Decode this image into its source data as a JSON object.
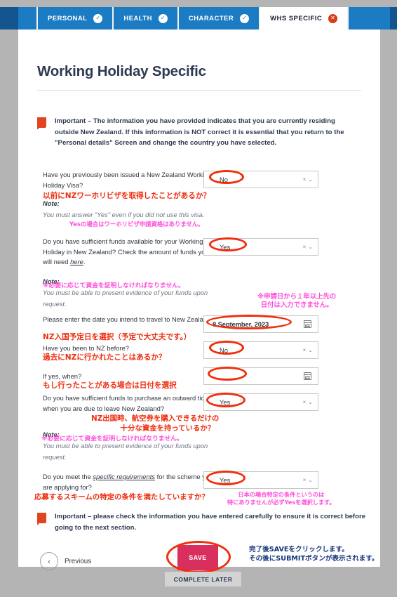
{
  "tabs": [
    {
      "label": "PERSONAL",
      "badge": "check",
      "active": false
    },
    {
      "label": "HEALTH",
      "badge": "check",
      "active": false
    },
    {
      "label": "CHARACTER",
      "badge": "check",
      "active": false
    },
    {
      "label": "WHS SPECIFIC",
      "badge": "error",
      "active": true
    }
  ],
  "page": {
    "title": "Working Holiday Specific"
  },
  "notices": {
    "top": "Important – The information you have provided indicates that you are currently residing outside New Zealand. If this information is NOT correct it is essential that you return to the \"Personal details\" Screen and change the country you have selected.",
    "bottom": "Important – please check the information you have entered carefully to ensure it is correct before going to the next section."
  },
  "questions": {
    "q1": {
      "text": "Have you previously been issued a New Zealand Working Holiday Visa?",
      "jp": "以前にNZワーホリビザを取得したことがあるか？",
      "note_label": "Note:",
      "note_body": "You must answer \"Yes\" even if you did not use this visa.",
      "note_jp": "Yesの場合はワーホリビザ申請資格はありません。",
      "value": "No"
    },
    "q2": {
      "text_a": "Do you have sufficient funds available for your Working Holiday in New Zealand? Check the amount of funds you will need ",
      "link": "here",
      "text_b": ".",
      "note_label": "Note:",
      "note_jp": "※必要に応じて資金を証明しなければなりません。",
      "note_body": "You must be able to present evidence of your funds upon request.",
      "value": "Yes"
    },
    "q3": {
      "text": "Please enter the date you intend to travel to New Zealand",
      "jp": "NZ入国予定日を選択（予定で大丈夫です。）",
      "value": "8 September, 2023",
      "jp_side": "※申請日から１年以上先の\n日付は入力できません。"
    },
    "q4": {
      "text": "Have you been to NZ before?",
      "jp": "過去にNZに行かれたことはあるか？",
      "value": "No"
    },
    "q5": {
      "text": "If yes, when?",
      "jp": "もし行ったことがある場合は日付を選択",
      "value": ""
    },
    "q6": {
      "text": "Do you have sufficient funds to purchase an outward ticket when you are due to leave New Zealand?",
      "jp": "NZ出国時、航空券を購入できるだけの\n　　　　十分な資金を持っているか？",
      "note_label": "Note:",
      "note_jp": "※必要に応じて資金を証明しなければなりません。",
      "note_body": "You must be able to present evidence of your funds upon request.",
      "value": "Yes"
    },
    "q7": {
      "text_a": "Do you meet the ",
      "link": "specific requirements",
      "text_b": " for the scheme you are applying for?",
      "jp": "応募するスキームの特定の条件を満たしていますか？",
      "jp_side": "日本の場合特定の条件というのは\n特にありませんが必ずYesを選択します。",
      "value": "Yes"
    }
  },
  "footer": {
    "previous": "Previous",
    "save": "SAVE",
    "complete_later": "COMPLETE LATER",
    "jp_note": "完了後SAVEをクリックします。\nその後にSUBMITボタンが表示されます。"
  },
  "icons": {
    "clear": "×",
    "chevron": "⌄",
    "check": "✓",
    "error": "✕",
    "prev_arrow": "‹"
  },
  "colors": {
    "tab_blue": "#1b7cc4",
    "tab_blue_dark": "#14558f",
    "title": "#2e3a52",
    "flag": "#e0451f",
    "annotation_red": "#ef2d0e",
    "annotation_pink": "#ff4ddb",
    "annotation_blue": "#12347a",
    "save": "#d92f5f",
    "ellipse": "#f02e0b"
  }
}
